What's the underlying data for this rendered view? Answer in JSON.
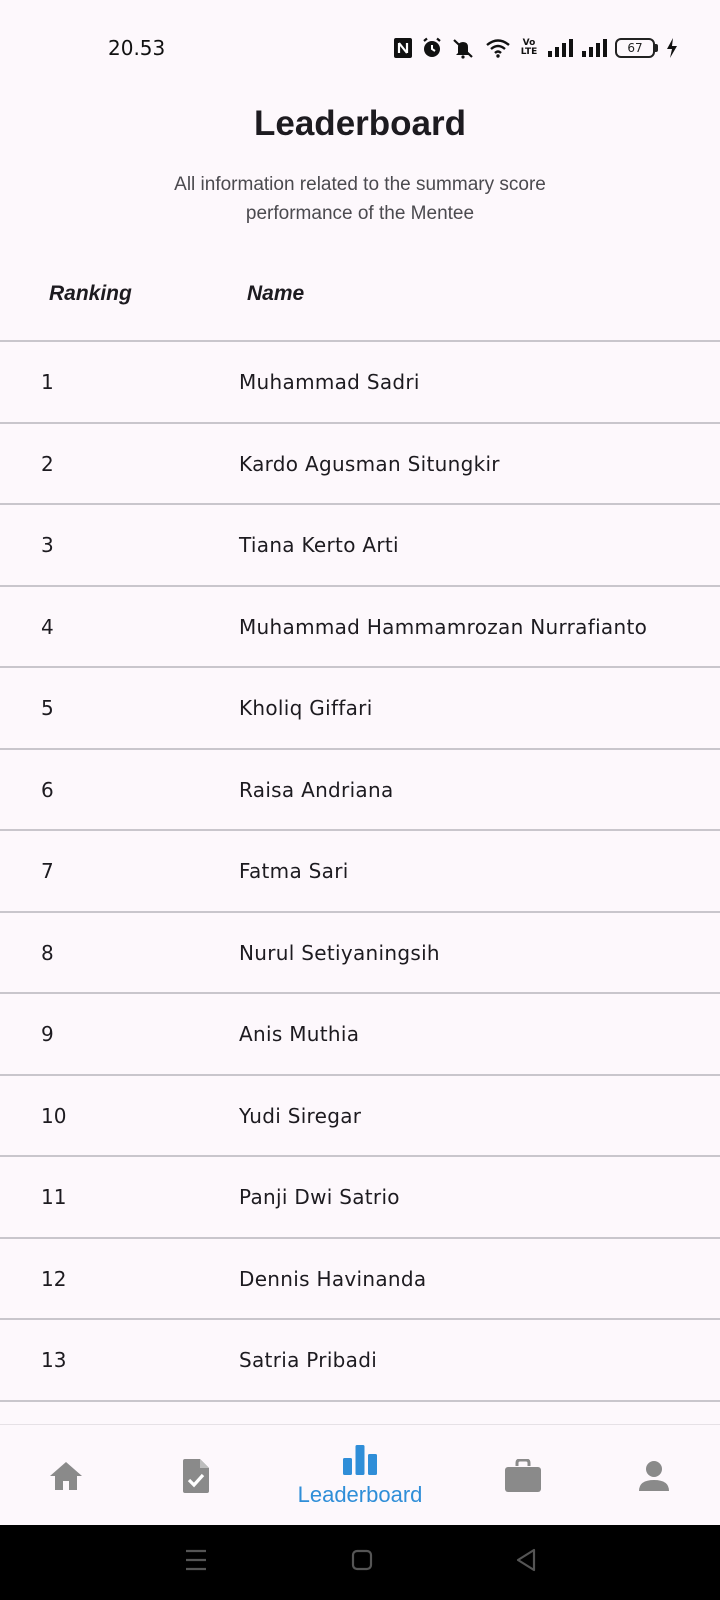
{
  "status_bar": {
    "time": "20.53",
    "battery_level": "67",
    "network_label": "Vo LTE"
  },
  "header": {
    "title": "Leaderboard",
    "subtitle": "All information related to the summary score performance of the Mentee"
  },
  "table": {
    "columns": {
      "ranking": "Ranking",
      "name": "Name"
    },
    "rows": [
      {
        "rank": "1",
        "name": "Muhammad Sadri"
      },
      {
        "rank": "2",
        "name": "Kardo Agusman Situngkir"
      },
      {
        "rank": "3",
        "name": "Tiana Kerto Arti"
      },
      {
        "rank": "4",
        "name": "Muhammad Hammamrozan Nurrafianto"
      },
      {
        "rank": "5",
        "name": "Kholiq Giffari"
      },
      {
        "rank": "6",
        "name": "Raisa Andriana"
      },
      {
        "rank": "7",
        "name": "Fatma Sari"
      },
      {
        "rank": "8",
        "name": "Nurul Setiyaningsih"
      },
      {
        "rank": "9",
        "name": "Anis Muthia"
      },
      {
        "rank": "10",
        "name": "Yudi Siregar"
      },
      {
        "rank": "11",
        "name": "Panji Dwi Satrio"
      },
      {
        "rank": "12",
        "name": "Dennis Havinanda"
      },
      {
        "rank": "13",
        "name": "Satria Pribadi"
      }
    ]
  },
  "bottom_nav": {
    "items": [
      {
        "icon": "home-icon",
        "label": ""
      },
      {
        "icon": "task-check-icon",
        "label": ""
      },
      {
        "icon": "leaderboard-icon",
        "label": "Leaderboard",
        "active": true
      },
      {
        "icon": "briefcase-icon",
        "label": ""
      },
      {
        "icon": "person-icon",
        "label": ""
      }
    ],
    "active_color": "#2f8ed8",
    "inactive_color": "#8a8a8a"
  },
  "colors": {
    "background": "#fdf8fc",
    "divider": "#c9c6cc",
    "accent": "#2f8ed8"
  }
}
